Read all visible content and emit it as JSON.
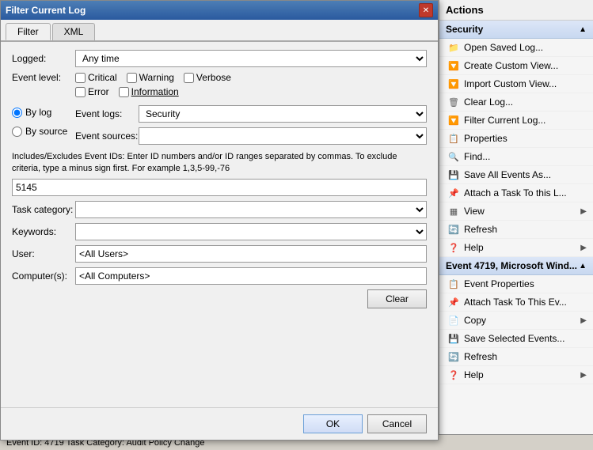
{
  "dialog": {
    "title": "Filter Current Log",
    "close_label": "✕",
    "tabs": [
      {
        "label": "Filter",
        "active": true
      },
      {
        "label": "XML",
        "active": false
      }
    ],
    "logged_label": "Logged:",
    "logged_value": "Any time",
    "event_level_label": "Event level:",
    "checkboxes": [
      {
        "label": "Critical",
        "checked": false
      },
      {
        "label": "Warning",
        "checked": false
      },
      {
        "label": "Verbose",
        "checked": false
      },
      {
        "label": "Error",
        "checked": false
      },
      {
        "label": "Information",
        "checked": false
      }
    ],
    "by_log_label": "By log",
    "by_source_label": "By source",
    "event_logs_label": "Event logs:",
    "event_logs_value": "Security",
    "event_sources_label": "Event sources:",
    "event_sources_value": "",
    "description": "Includes/Excludes Event IDs: Enter ID numbers and/or ID ranges separated by commas. To exclude criteria, type a minus sign first. For example 1,3,5-99,-76",
    "event_id_value": "5145",
    "task_category_label": "Task category:",
    "keywords_label": "Keywords:",
    "user_label": "User:",
    "user_value": "<All Users>",
    "computers_label": "Computer(s):",
    "computers_value": "<All Computers>",
    "clear_btn": "Clear",
    "ok_btn": "OK",
    "cancel_btn": "Cancel"
  },
  "bottom_bar": {
    "text": "Event ID:     4719     Task Category:  Audit Policy Change"
  },
  "actions": {
    "header": "Actions",
    "sections": [
      {
        "title": "Security",
        "items": [
          {
            "label": "Open Saved Log...",
            "icon": "folder",
            "has_arrow": false
          },
          {
            "label": "Create Custom View...",
            "icon": "filter",
            "has_arrow": false
          },
          {
            "label": "Import Custom View...",
            "icon": "filter",
            "has_arrow": false
          },
          {
            "label": "Clear Log...",
            "icon": "clear",
            "has_arrow": false
          },
          {
            "label": "Filter Current Log...",
            "icon": "filter",
            "has_arrow": false
          },
          {
            "label": "Properties",
            "icon": "props",
            "has_arrow": false
          },
          {
            "label": "Find...",
            "icon": "find",
            "has_arrow": false
          },
          {
            "label": "Save All Events As...",
            "icon": "save",
            "has_arrow": false
          },
          {
            "label": "Attach a Task To this L...",
            "icon": "attach",
            "has_arrow": false
          },
          {
            "label": "View",
            "icon": "view",
            "has_arrow": true
          },
          {
            "label": "Refresh",
            "icon": "refresh",
            "has_arrow": false
          },
          {
            "label": "Help",
            "icon": "help",
            "has_arrow": true
          }
        ]
      },
      {
        "title": "Event 4719, Microsoft Wind...",
        "items": [
          {
            "label": "Event Properties",
            "icon": "props",
            "has_arrow": false
          },
          {
            "label": "Attach Task To This Ev...",
            "icon": "attach",
            "has_arrow": false
          },
          {
            "label": "Copy",
            "icon": "copy",
            "has_arrow": true
          },
          {
            "label": "Save Selected Events...",
            "icon": "save",
            "has_arrow": false
          },
          {
            "label": "Refresh",
            "icon": "refresh",
            "has_arrow": false
          },
          {
            "label": "Help",
            "icon": "help",
            "has_arrow": true
          }
        ]
      }
    ]
  }
}
